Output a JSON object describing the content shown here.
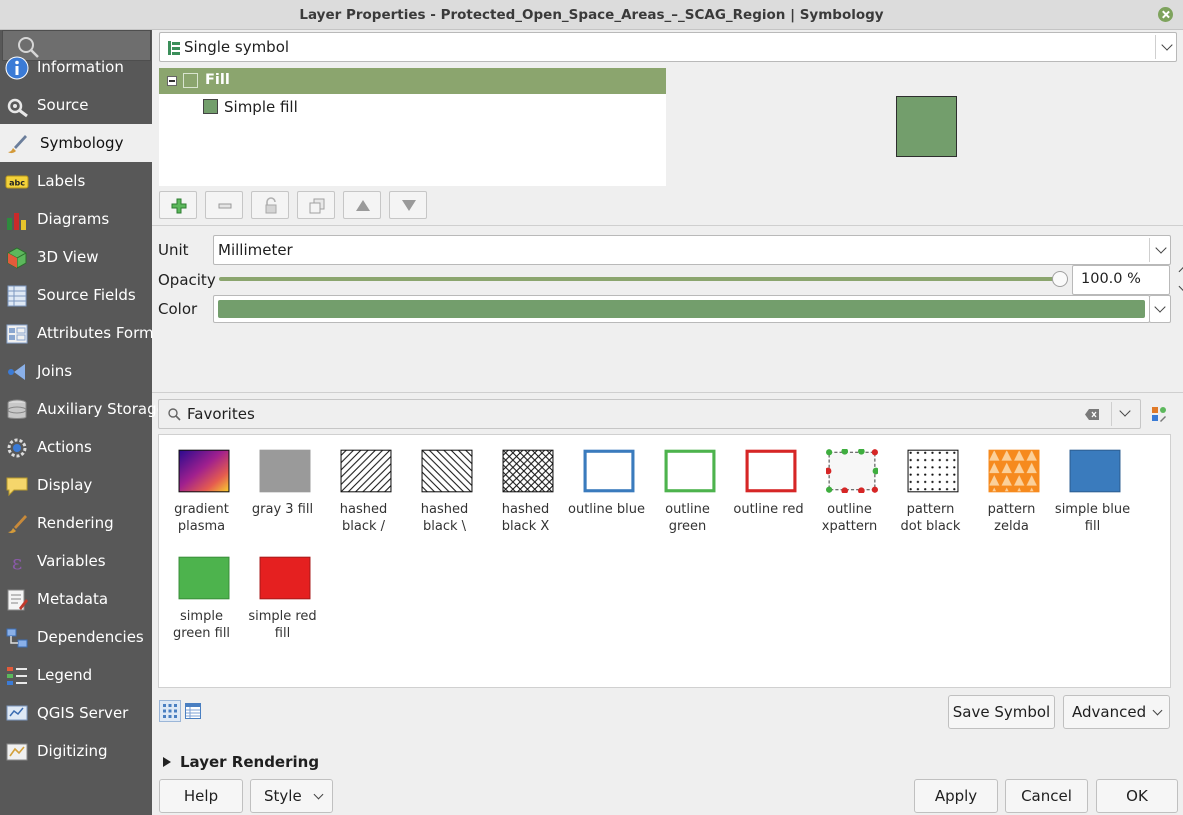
{
  "window": {
    "title": "Layer Properties - Protected_Open_Space_Areas_–_SCAG_Region | Symbology"
  },
  "sidebar": {
    "items": [
      {
        "label": "Information",
        "icon": "info-icon"
      },
      {
        "label": "Source",
        "icon": "source-wrench-icon"
      },
      {
        "label": "Symbology",
        "icon": "paintbrush-icon"
      },
      {
        "label": "Labels",
        "icon": "labels-abc-icon"
      },
      {
        "label": "Diagrams",
        "icon": "diagrams-icon"
      },
      {
        "label": "3D View",
        "icon": "cube-icon"
      },
      {
        "label": "Source Fields",
        "icon": "fields-icon"
      },
      {
        "label": "Attributes Form",
        "icon": "form-icon"
      },
      {
        "label": "Joins",
        "icon": "joins-icon"
      },
      {
        "label": "Auxiliary Storage",
        "icon": "database-icon"
      },
      {
        "label": "Actions",
        "icon": "actions-gear-icon"
      },
      {
        "label": "Display",
        "icon": "speech-bubble-icon"
      },
      {
        "label": "Rendering",
        "icon": "brush-icon"
      },
      {
        "label": "Variables",
        "icon": "epsilon-icon"
      },
      {
        "label": "Metadata",
        "icon": "metadata-icon"
      },
      {
        "label": "Dependencies",
        "icon": "dependencies-icon"
      },
      {
        "label": "Legend",
        "icon": "legend-icon"
      },
      {
        "label": "QGIS Server",
        "icon": "server-icon"
      },
      {
        "label": "Digitizing",
        "icon": "digitizing-icon"
      }
    ],
    "active_index": 2
  },
  "renderer": {
    "selected": "Single symbol"
  },
  "symbol_tree": {
    "root": "Fill",
    "child": "Simple fill"
  },
  "colors": {
    "fill": "#739e6c",
    "accent": "#8ba56e"
  },
  "props": {
    "unit_label": "Unit",
    "unit_value": "Millimeter",
    "opacity_label": "Opacity",
    "opacity_value": "100.0 %",
    "opacity_fraction": 1.0,
    "color_label": "Color"
  },
  "favorites": {
    "search_value": "Favorites",
    "symbols": [
      {
        "line1": "gradient",
        "line2": "plasma",
        "kind": "gradient"
      },
      {
        "line1": "gray 3 fill",
        "line2": "",
        "kind": "gray"
      },
      {
        "line1": "hashed",
        "line2": "black /",
        "kind": "hash-fwd"
      },
      {
        "line1": "hashed",
        "line2": "black \\",
        "kind": "hash-back"
      },
      {
        "line1": "hashed",
        "line2": "black X",
        "kind": "hash-x"
      },
      {
        "line1": "outline blue",
        "line2": "",
        "kind": "outline-blue"
      },
      {
        "line1": "outline",
        "line2": "green",
        "kind": "outline-green"
      },
      {
        "line1": "outline red",
        "line2": "",
        "kind": "outline-red"
      },
      {
        "line1": "outline",
        "line2": "xpattern",
        "kind": "xpattern"
      },
      {
        "line1": "pattern",
        "line2": "dot black",
        "kind": "dots"
      },
      {
        "line1": "pattern",
        "line2": "zelda",
        "kind": "zelda"
      },
      {
        "line1": "simple blue",
        "line2": "fill",
        "kind": "blue"
      },
      {
        "line1": "simple",
        "line2": "green fill",
        "kind": "green"
      },
      {
        "line1": "simple red",
        "line2": "fill",
        "kind": "red"
      }
    ]
  },
  "buttons": {
    "save_symbol": "Save Symbol",
    "advanced": "Advanced",
    "layer_rendering": "Layer Rendering",
    "help": "Help",
    "style": "Style",
    "apply": "Apply",
    "cancel": "Cancel",
    "ok": "OK"
  }
}
